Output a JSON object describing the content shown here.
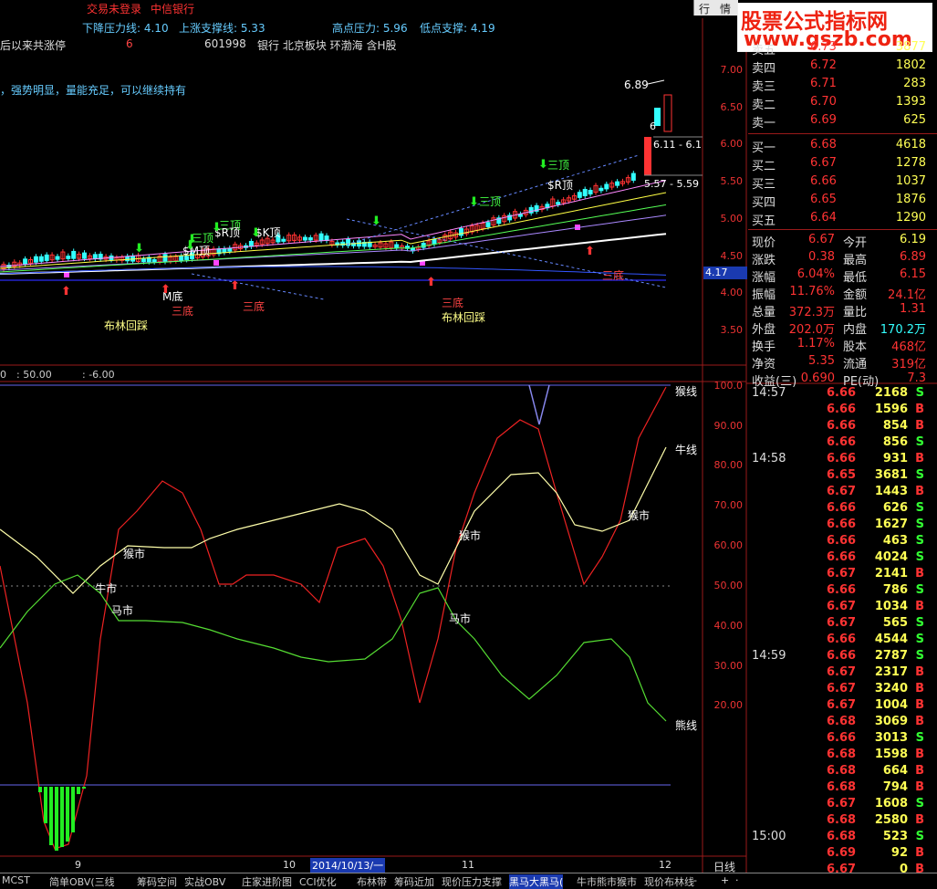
{
  "top_bar": {
    "status": "交易未登录",
    "broker": "中信银行",
    "btn_quote": "行",
    "btn_info": "情"
  },
  "logo": {
    "line1": "股票公式指标网",
    "line2": "www.gszb.com"
  },
  "info_line1": {
    "down_pressure": "下降压力线: 4.10",
    "up_support": "上涨支撑线: 5.33",
    "high_pressure": "高点压力: 5.96",
    "low_support": "低点支撑: 4.19"
  },
  "info_line2": {
    "prefix": "后以来共涨停",
    "count": "6",
    "code": "601998",
    "tags": "银行 北京板块 环渤海 含H股"
  },
  "info_line3": "，强势明显，量能充足，可以继续持有",
  "price_axis": [
    "7.00",
    "6.50",
    "6.00",
    "5.50",
    "5.00",
    "4.50",
    "4.00",
    "3.50"
  ],
  "current_price_tag": "4.17",
  "annotations": {
    "high_val": "6.89",
    "range1": "6.11 - 6.1",
    "range2": "5.57 - 5.59",
    "small_6": "6",
    "sanding": "三顶",
    "rding": "$R顶",
    "kding": "$K顶",
    "mding": "$M顶",
    "sandi": "三底",
    "mdi": "M底",
    "bulin": "布林回踩"
  },
  "divider_label": {
    "a": "0",
    "b": ": 50.00",
    "c": ": -6.00"
  },
  "osc_axis": [
    "100.0",
    "90.00",
    "80.00",
    "70.00",
    "60.00",
    "50.00",
    "40.00",
    "30.00",
    "20.00"
  ],
  "osc_labels": {
    "monkey_line": "猴线",
    "bull_line": "牛线",
    "bear_line": "熊线",
    "monkey_mkt": "猴市",
    "bull_mkt": "牛市",
    "horse_mkt": "马市"
  },
  "date_axis": {
    "m9": "9",
    "m10": "10",
    "sel": "2014/10/13/一",
    "m11": "11",
    "m12": "12"
  },
  "quote_panel": {
    "asks": [
      {
        "label": "卖五",
        "price": "6.73",
        "vol": "3877"
      },
      {
        "label": "卖四",
        "price": "6.72",
        "vol": "1802"
      },
      {
        "label": "卖三",
        "price": "6.71",
        "vol": "283"
      },
      {
        "label": "卖二",
        "price": "6.70",
        "vol": "1393"
      },
      {
        "label": "卖一",
        "price": "6.69",
        "vol": "625"
      }
    ],
    "bids": [
      {
        "label": "买一",
        "price": "6.68",
        "vol": "4618"
      },
      {
        "label": "买二",
        "price": "6.67",
        "vol": "1278"
      },
      {
        "label": "买三",
        "price": "6.66",
        "vol": "1037"
      },
      {
        "label": "买四",
        "price": "6.65",
        "vol": "1876"
      },
      {
        "label": "买五",
        "price": "6.64",
        "vol": "1290"
      }
    ],
    "stats": [
      {
        "k1": "现价",
        "v1": "6.67",
        "k2": "今开",
        "v2": "6.19"
      },
      {
        "k1": "涨跌",
        "v1": "0.38",
        "k2": "最高",
        "v2": "6.89"
      },
      {
        "k1": "涨幅",
        "v1": "6.04%",
        "k2": "最低",
        "v2": "6.15"
      },
      {
        "k1": "振幅",
        "v1": "11.76%",
        "k2": "金额",
        "v2": "24.1亿"
      },
      {
        "k1": "总量",
        "v1": "372.3万",
        "k2": "量比",
        "v2": "1.31"
      },
      {
        "k1": "外盘",
        "v1": "202.0万",
        "k2": "内盘",
        "v2": "170.2万"
      },
      {
        "k1": "换手",
        "v1": "1.17%",
        "k2": "股本",
        "v2": "468亿"
      },
      {
        "k1": "净资",
        "v1": "5.35",
        "k2": "流通",
        "v2": "319亿"
      },
      {
        "k1": "收益(三)",
        "v1": "0.690",
        "k2": "PE(动)",
        "v2": "7.3"
      }
    ]
  },
  "ticks": [
    {
      "time": "14:57",
      "price": "6.66",
      "vol": "2168",
      "side": "S"
    },
    {
      "time": "",
      "price": "6.66",
      "vol": "1596",
      "side": "B"
    },
    {
      "time": "",
      "price": "6.66",
      "vol": "854",
      "side": "B"
    },
    {
      "time": "",
      "price": "6.66",
      "vol": "856",
      "side": "S"
    },
    {
      "time": "14:58",
      "price": "6.66",
      "vol": "931",
      "side": "B"
    },
    {
      "time": "",
      "price": "6.65",
      "vol": "3681",
      "side": "S"
    },
    {
      "time": "",
      "price": "6.67",
      "vol": "1443",
      "side": "B"
    },
    {
      "time": "",
      "price": "6.66",
      "vol": "626",
      "side": "S"
    },
    {
      "time": "",
      "price": "6.66",
      "vol": "1627",
      "side": "S"
    },
    {
      "time": "",
      "price": "6.66",
      "vol": "463",
      "side": "S"
    },
    {
      "time": "",
      "price": "6.66",
      "vol": "4024",
      "side": "S"
    },
    {
      "time": "",
      "price": "6.67",
      "vol": "2141",
      "side": "B"
    },
    {
      "time": "",
      "price": "6.66",
      "vol": "786",
      "side": "S"
    },
    {
      "time": "",
      "price": "6.67",
      "vol": "1034",
      "side": "B"
    },
    {
      "time": "",
      "price": "6.67",
      "vol": "565",
      "side": "S"
    },
    {
      "time": "",
      "price": "6.66",
      "vol": "4544",
      "side": "S"
    },
    {
      "time": "14:59",
      "price": "6.66",
      "vol": "2787",
      "side": "S"
    },
    {
      "time": "",
      "price": "6.67",
      "vol": "2317",
      "side": "B"
    },
    {
      "time": "",
      "price": "6.67",
      "vol": "3240",
      "side": "B"
    },
    {
      "time": "",
      "price": "6.67",
      "vol": "1004",
      "side": "B"
    },
    {
      "time": "",
      "price": "6.68",
      "vol": "3069",
      "side": "B"
    },
    {
      "time": "",
      "price": "6.66",
      "vol": "3013",
      "side": "S"
    },
    {
      "time": "",
      "price": "6.68",
      "vol": "1598",
      "side": "B"
    },
    {
      "time": "",
      "price": "6.68",
      "vol": "664",
      "side": "B"
    },
    {
      "time": "",
      "price": "6.68",
      "vol": "794",
      "side": "B"
    },
    {
      "time": "",
      "price": "6.67",
      "vol": "1608",
      "side": "S"
    },
    {
      "time": "",
      "price": "6.68",
      "vol": "2580",
      "side": "B"
    },
    {
      "time": "15:00",
      "price": "6.68",
      "vol": "523",
      "side": "S"
    },
    {
      "time": "",
      "price": "6.69",
      "vol": "92",
      "side": "B"
    },
    {
      "time": "",
      "price": "6.67",
      "vol": "0",
      "side": "B"
    }
  ],
  "bottom_tabs": [
    "MCST",
    "简单OBV(三线",
    "筹码空间",
    "实战OBV",
    "庄家进阶图",
    "CCI优化",
    "布林带",
    "筹码近加",
    "现价压力支撑",
    "黑马大黑马(",
    "牛市熊市猴市",
    "现价布林线"
  ],
  "bottom_right": {
    "period": "日线",
    "minus": "-",
    "plus": "+",
    "dot": "·"
  },
  "colors": {
    "up": "#ff3333",
    "down": "#33ffff",
    "bull": "#ffffaa",
    "bear": "#55dd33",
    "monkey": "#ee2222",
    "frame": "#9a1a1a"
  }
}
